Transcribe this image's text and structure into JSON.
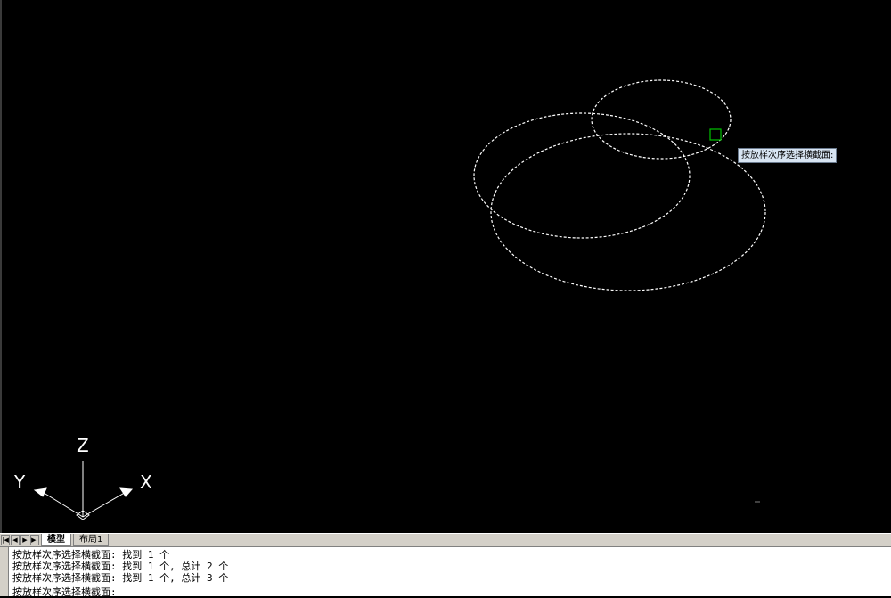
{
  "tooltip": {
    "text": "按放样次序选择横截面:"
  },
  "ucs": {
    "x_label": "X",
    "y_label": "Y",
    "z_label": "Z"
  },
  "tabs": {
    "nav_first": "|◀",
    "nav_prev": "◀",
    "nav_next": "▶",
    "nav_last": "▶|",
    "model": "模型",
    "layout1": "布局1"
  },
  "command": {
    "history": [
      "按放样次序选择横截面: 找到 1 个",
      "按放样次序选择横截面: 找到 1 个, 总计 2 个",
      "按放样次序选择横截面: 找到 1 个, 总计 3 个"
    ],
    "prompt": "按放样次序选择横截面:"
  },
  "colors": {
    "canvas": "#000000",
    "selected_curve": "#ffffff",
    "pickbox": "#00c000",
    "tooltip_bg": "#d7e4f2"
  }
}
